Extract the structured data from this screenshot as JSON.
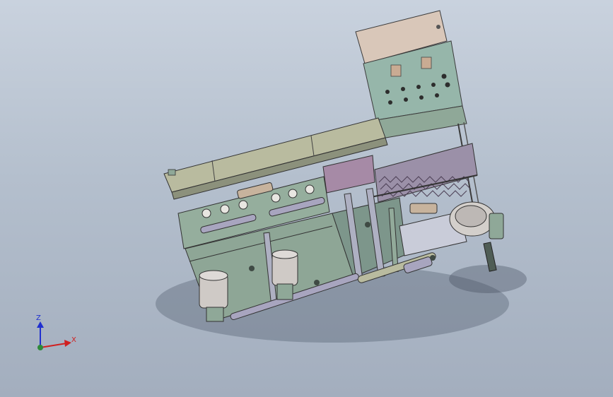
{
  "scene": {
    "background_top": "#c9d2de",
    "background_bottom": "#a3aebe",
    "model_colors": {
      "frame": "#7c8f86",
      "panel": "#8fa898",
      "cabinet": "#d7c6b8",
      "cabinet_face": "#93b4a7",
      "tray": "#b8baa0",
      "pink_panel": "#a48aa5",
      "tubes": "#a8a6bf",
      "motor": "#cfcac7",
      "mesh": "#9c91a6"
    }
  },
  "triad": {
    "z_label": "Z",
    "x_label": "X",
    "z_color": "#1f2fd0",
    "x_color": "#d02020",
    "origin_color": "#2e8a3a"
  }
}
